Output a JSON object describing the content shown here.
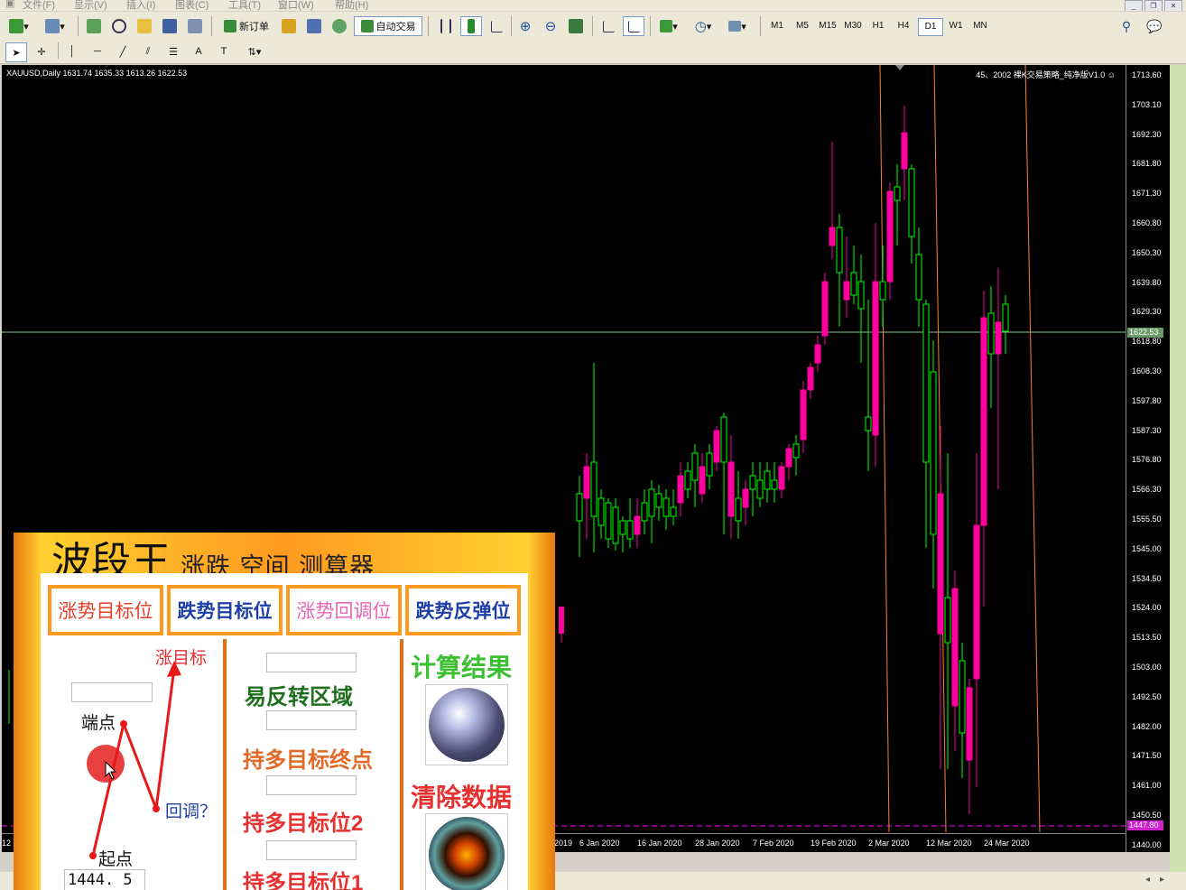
{
  "menu": {
    "file": "文件(F)",
    "view": "显示(V)",
    "insert": "插入(I)",
    "charts": "图表(C)",
    "tools": "工具(T)",
    "window": "窗口(W)",
    "help": "帮助(H)"
  },
  "toolbar": {
    "new_order": "新订单",
    "autotrade": "自动交易",
    "timeframes": [
      "M1",
      "M5",
      "M15",
      "M30",
      "H1",
      "H4",
      "D1",
      "W1",
      "MN"
    ],
    "active_timeframe": "D1"
  },
  "chart": {
    "symbol_line": "XAUUSD,Daily  1631.74 1635.33 1613.26 1622.53",
    "indicator_label": "45、2002 裸K交易策略_纯净版V1.0",
    "price_ticks": [
      "1713.60",
      "1703.10",
      "1692.30",
      "1681.80",
      "1671.30",
      "1660.80",
      "1650.30",
      "1639.80",
      "1629.30",
      "1618.80",
      "1608.30",
      "1597.80",
      "1587.30",
      "1576.80",
      "1566.30",
      "1555.50",
      "1545.00",
      "1534.50",
      "1524.00",
      "1513.50",
      "1503.00",
      "1492.50",
      "1482.00",
      "1471.50",
      "1461.00",
      "1450.50",
      "1440.00"
    ],
    "current_price": "1622.53",
    "marked_price": "1447.80",
    "time_ticks": [
      "12",
      "2019",
      "6 Jan 2020",
      "16 Jan 2020",
      "28 Jan 2020",
      "7 Feb 2020",
      "19 Feb 2020",
      "2 Mar 2020",
      "12 Mar 2020",
      "24 Mar 2020"
    ],
    "colors": {
      "up": "#00ff00",
      "down": "#ff00a0",
      "grid_line": "#8fbf8f",
      "vline": "#ff7f27",
      "dash_line": "#ff00ff"
    }
  },
  "panel": {
    "title": "波段王",
    "subtitle": "涨跌 空间 测算器",
    "tabs": [
      {
        "label": "涨势目标位",
        "color": "#e8402a"
      },
      {
        "label": "跌势目标位",
        "color": "#1f3fa8"
      },
      {
        "label": "涨势回调位",
        "color": "#e864b4"
      },
      {
        "label": "跌势反弹位",
        "color": "#1f3fa8"
      }
    ],
    "diagram": {
      "up_target": "涨目标",
      "end_point": "端点",
      "retrace": "回调？",
      "start_point": "起点",
      "start_value": "1444. 5"
    },
    "zones": {
      "reversal": "易反转区域",
      "long_final": "持多目标终点",
      "long_target2": "持多目标位2",
      "long_target1": "持多目标位1"
    },
    "actions": {
      "calculate": "计算结果",
      "clear": "清除数据"
    }
  }
}
